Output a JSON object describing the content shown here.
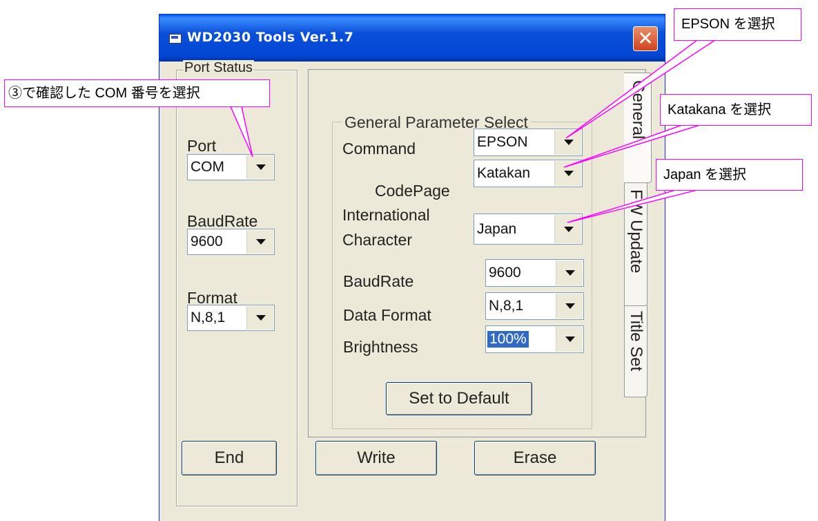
{
  "window": {
    "title": "WD2030 Tools Ver.1.7"
  },
  "port_settings": {
    "group_title": "Port Status",
    "port_label": "Port",
    "port_value": "COM",
    "baud_label": "BaudRate",
    "baud_value": "9600",
    "format_label": "Format",
    "format_value": "N,8,1",
    "end_button": "End"
  },
  "tabs": [
    {
      "label": "General"
    },
    {
      "label": "FW Update"
    },
    {
      "label": "Title Set"
    }
  ],
  "general": {
    "group_title": "General Parameter Select",
    "command_label": "Command",
    "command_value": "EPSON",
    "codepage_label": "CodePage",
    "codepage_value": "Katakan",
    "intl_label_1": "International",
    "intl_label_2": "Character",
    "intl_value": "Japan",
    "baud_label": "BaudRate",
    "baud_value": "9600",
    "dataformat_label": "Data Format",
    "dataformat_value": "N,8,1",
    "brightness_label": "Brightness",
    "brightness_value": "100%",
    "default_button": "Set to Default"
  },
  "buttons": {
    "write": "Write",
    "erase": "Erase"
  },
  "callouts": {
    "com": "③で確認した COM 番号を選択",
    "epson": "EPSON を選択",
    "katakana": "Katakana を選択",
    "japan": "Japan を選択"
  },
  "colors": {
    "callout_border": "#ff00ff",
    "titlebar": "#0247d4",
    "selection": "#316ac5"
  }
}
